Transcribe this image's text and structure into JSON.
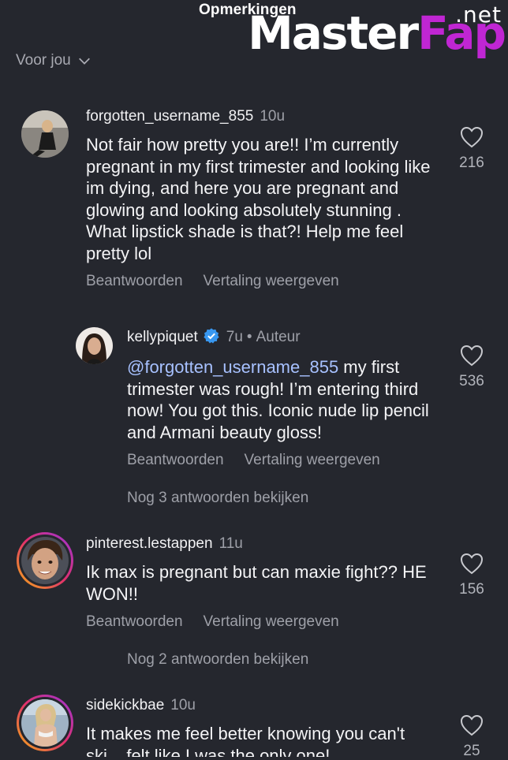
{
  "header": {
    "title": "Opmerkingen"
  },
  "watermark": {
    "net": ".net",
    "part1": "Master",
    "part2": "Fap"
  },
  "filter": {
    "label": "Voor jou"
  },
  "comments": [
    {
      "username": "forgotten_username_855",
      "time": "10u",
      "text": "Not fair how pretty you are!! I’m currently pregnant in my first trimester and looking like im dying, and here you are pregnant and glowing and looking absolutely stunning . What lipstick shade is that?! Help me feel pretty lol",
      "reply_label": "Beantwoorden",
      "translate_label": "Vertaling weergeven",
      "likes": "216"
    },
    {
      "username": "kellypiquet",
      "time": "7u",
      "author_label": "Auteur",
      "mention": "@forgotten_username_855",
      "text": " my first trimester was rough! I’m entering third now! You got this. Iconic nude lip pencil and Armani beauty gloss!",
      "reply_label": "Beantwoorden",
      "translate_label": "Vertaling weergeven",
      "likes": "536",
      "more_replies": "Nog 3 antwoorden bekijken"
    },
    {
      "username": "pinterest.lestappen",
      "time": "11u",
      "text": "Ik max is pregnant but can maxie fight?? HE WON!!",
      "reply_label": "Beantwoorden",
      "translate_label": "Vertaling weergeven",
      "likes": "156",
      "more_replies": "Nog 2 antwoorden bekijken"
    },
    {
      "username": "sidekickbae",
      "time": "10u",
      "text": "It makes me feel better knowing you can't ski... felt like I was the only one!",
      "likes": "25"
    }
  ],
  "colors": {
    "verified": "#3897f0",
    "mention": "#a7c1ff",
    "background": "#25272e"
  }
}
